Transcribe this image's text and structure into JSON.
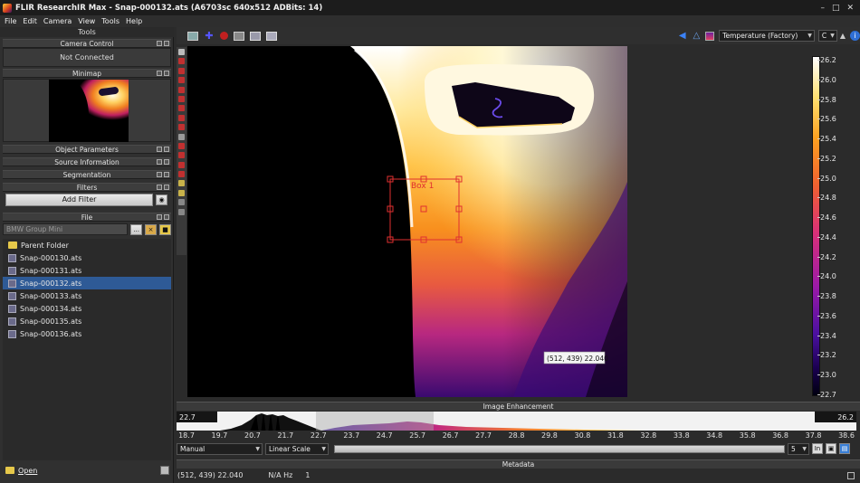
{
  "window": {
    "title": "FLIR ResearchIR Max - Snap-000132.ats (A6703sc 640x512 ADBits: 14)"
  },
  "menu": [
    "File",
    "Edit",
    "Camera",
    "View",
    "Tools",
    "Help"
  ],
  "left": {
    "tools_title": "Tools",
    "camera_control": {
      "header": "Camera Control",
      "status": "Not Connected"
    },
    "minimap": {
      "header": "Minimap"
    },
    "sections": [
      "Object Parameters",
      "Source Information",
      "Segmentation"
    ],
    "filters": {
      "header": "Filters",
      "add_filter": "Add Filter"
    },
    "file": {
      "header": "File",
      "folder": "BMW Group Mini",
      "browse_label": "...",
      "items": [
        {
          "label": "Parent Folder",
          "type": "folder"
        },
        {
          "label": "Snap-000130.ats",
          "type": "file"
        },
        {
          "label": "Snap-000131.ats",
          "type": "file"
        },
        {
          "label": "Snap-000132.ats",
          "type": "file",
          "selected": true
        },
        {
          "label": "Snap-000133.ats",
          "type": "file"
        },
        {
          "label": "Snap-000134.ats",
          "type": "file"
        },
        {
          "label": "Snap-000135.ats",
          "type": "file"
        },
        {
          "label": "Snap-000136.ats",
          "type": "file"
        }
      ],
      "open_label": "Open"
    }
  },
  "toolbar": {
    "temperature_mode": "Temperature (Factory)",
    "unit": "C"
  },
  "image": {
    "roi_label": "Box 1",
    "cursor_readout": "(512, 439) 22.040"
  },
  "colorbar": {
    "ticks": [
      "26.2",
      "26.0",
      "25.8",
      "25.6",
      "25.4",
      "25.2",
      "25.0",
      "24.8",
      "24.6",
      "24.4",
      "24.2",
      "24.0",
      "23.8",
      "23.6",
      "23.4",
      "23.2",
      "23.0",
      "22.7"
    ]
  },
  "enhancement": {
    "header": "Image Enhancement",
    "min": "22.7",
    "max": "26.2",
    "axis_ticks": [
      "18.7",
      "19.7",
      "20.7",
      "21.7",
      "22.7",
      "23.7",
      "24.7",
      "25.7",
      "26.7",
      "27.7",
      "28.8",
      "29.8",
      "30.8",
      "31.8",
      "32.8",
      "33.8",
      "34.8",
      "35.8",
      "36.8",
      "37.8",
      "38.6"
    ],
    "mode": "Manual",
    "scale": "Linear Scale",
    "step": "5",
    "in_label": "In"
  },
  "metadata": {
    "header": "Metadata",
    "readout": "(512, 439) 22.040",
    "rate": "N/A Hz",
    "frame": "1"
  }
}
